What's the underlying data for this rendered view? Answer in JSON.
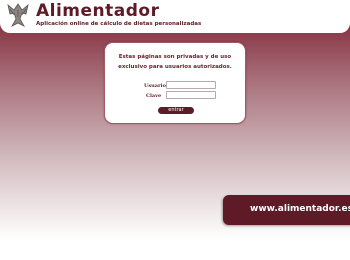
{
  "header": {
    "title": "Alimentador",
    "subtitle": "Aplicación online de cálculo de dietas personalizadas",
    "logo_icon": "bird-emblem-icon"
  },
  "login": {
    "notice": "Estas páginas son privadas y de uso exclusivo para usuarios autorizados.",
    "user_label": "Usuario",
    "password_label": "Clave",
    "user_value": "",
    "password_value": "",
    "submit_label": "entrar"
  },
  "banner": {
    "url": "www.alimentador.es"
  },
  "colors": {
    "brand": "#5e1a26",
    "background_top": "#6e2230"
  }
}
